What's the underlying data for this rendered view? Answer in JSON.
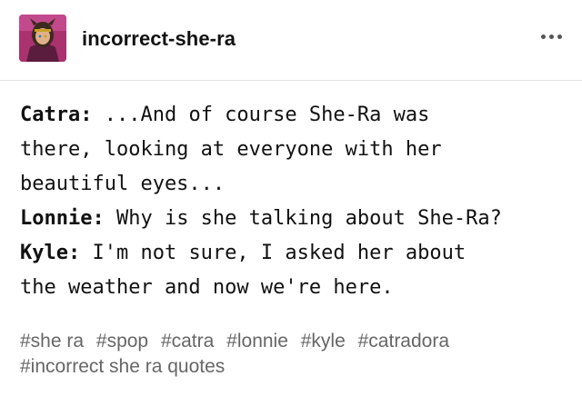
{
  "header": {
    "blog_name": "incorrect-she-ra",
    "more_icon": "ellipsis-horizontal-icon"
  },
  "post": {
    "lines": [
      {
        "speaker": "Catra:",
        "text": " ...And of course She-Ra was"
      },
      {
        "speaker": "",
        "text": "there, looking at everyone with her"
      },
      {
        "speaker": "",
        "text": "beautiful eyes..."
      },
      {
        "speaker": "Lonnie:",
        "text": " Why is she talking about She-Ra?"
      },
      {
        "speaker": "Kyle:",
        "text": " I'm not sure, I asked her about"
      },
      {
        "speaker": "",
        "text": "the weather and now we're here."
      }
    ]
  },
  "tags": {
    "row1": [
      "#she ra",
      "#spop",
      "#catra",
      "#lonnie",
      "#kyle",
      "#catradora"
    ],
    "row2": [
      "#incorrect she ra quotes"
    ]
  }
}
